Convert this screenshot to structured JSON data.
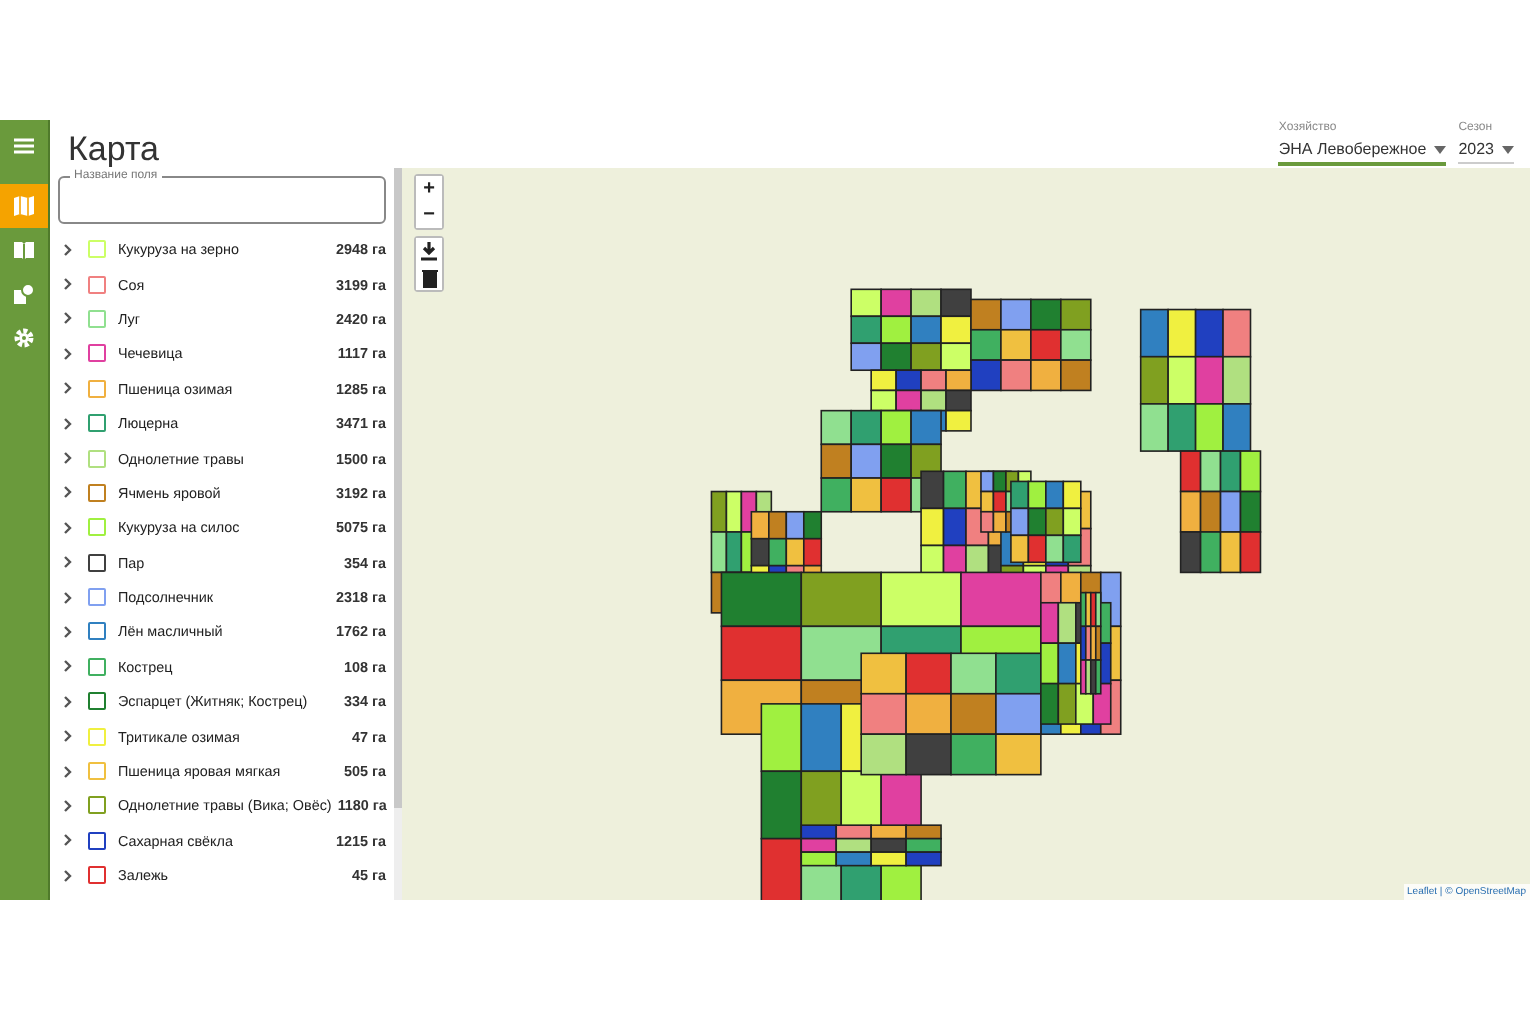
{
  "header": {
    "title": "Карта"
  },
  "rail": {
    "items": [
      {
        "kind": "menu",
        "selected": false
      },
      {
        "kind": "map",
        "selected": true
      },
      {
        "kind": "book",
        "selected": false
      },
      {
        "kind": "shapes",
        "selected": false
      },
      {
        "kind": "settings",
        "selected": false
      }
    ]
  },
  "filters": [
    {
      "label": "Хозяйство",
      "value": "ЭНА Левобережное",
      "underlined": true
    },
    {
      "label": "Сезон",
      "value": "2023",
      "underlined": false
    }
  ],
  "search": {
    "label": "Название поля"
  },
  "crops": [
    {
      "name": "Кукуруза на зерно",
      "area": "2948 га",
      "color": "#ccff66"
    },
    {
      "name": "Соя",
      "area": "3199 га",
      "color": "#f08080"
    },
    {
      "name": "Луг",
      "area": "2420 га",
      "color": "#90e090"
    },
    {
      "name": "Чечевица",
      "area": "1117 га",
      "color": "#e040a0"
    },
    {
      "name": "Пшеница озимая",
      "area": "1285 га",
      "color": "#f0b040"
    },
    {
      "name": "Люцерна",
      "area": "3471 га",
      "color": "#30a070"
    },
    {
      "name": "Однолетние травы",
      "area": "1500 га",
      "color": "#b0e080"
    },
    {
      "name": "Ячмень яровой",
      "area": "3192 га",
      "color": "#c08020"
    },
    {
      "name": "Кукуруза на силос",
      "area": "5075 га",
      "color": "#a0f040"
    },
    {
      "name": "Пар",
      "area": "354 га",
      "color": "#404040"
    },
    {
      "name": "Подсолнечник",
      "area": "2318 га",
      "color": "#80a0f0"
    },
    {
      "name": "Лён масличный",
      "area": "1762 га",
      "color": "#3080c0"
    },
    {
      "name": "Кострец",
      "area": "108 га",
      "color": "#40b060"
    },
    {
      "name": "Эспарцет (Житняк; Кострец)",
      "area": "334 га",
      "color": "#208030"
    },
    {
      "name": "Тритикале озимая",
      "area": "47 га",
      "color": "#f0f040"
    },
    {
      "name": "Пшеница яровая мягкая",
      "area": "505 га",
      "color": "#f0c040"
    },
    {
      "name": "Однолетние травы (Вика; Овёс)",
      "area": "1180 га",
      "color": "#80a020"
    },
    {
      "name": "Сахарная свёкла",
      "area": "1215 га",
      "color": "#2040c0"
    },
    {
      "name": "Залежь",
      "area": "45 га",
      "color": "#e03030"
    }
  ],
  "map": {
    "zoom_in": "+",
    "zoom_out": "−",
    "attribution": "Leaflet | © OpenStreetMap"
  }
}
